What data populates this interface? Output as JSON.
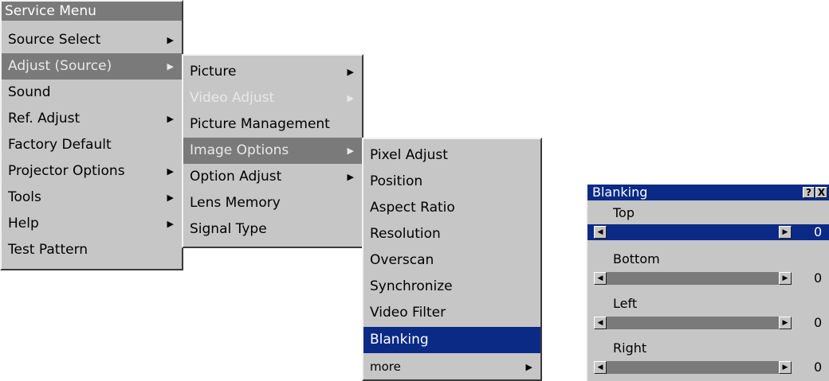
{
  "menu1": {
    "title": "Service Menu",
    "items": [
      {
        "label": "Source Select",
        "arrow": "▶"
      },
      {
        "label": "Adjust (Source)",
        "arrow": "▶"
      },
      {
        "label": "Sound",
        "arrow": ""
      },
      {
        "label": "Ref. Adjust",
        "arrow": "▶"
      },
      {
        "label": "Factory Default",
        "arrow": ""
      },
      {
        "label": "Projector Options",
        "arrow": "▶"
      },
      {
        "label": "Tools",
        "arrow": "▶"
      },
      {
        "label": "Help",
        "arrow": "▶"
      },
      {
        "label": "Test Pattern",
        "arrow": ""
      }
    ]
  },
  "menu2": {
    "items": [
      {
        "label": "Picture",
        "arrow": "▶"
      },
      {
        "label": "Video Adjust",
        "arrow": "▶"
      },
      {
        "label": "Picture Management",
        "arrow": ""
      },
      {
        "label": "Image Options",
        "arrow": "▶"
      },
      {
        "label": "Option Adjust",
        "arrow": "▶"
      },
      {
        "label": "Lens Memory",
        "arrow": ""
      },
      {
        "label": "Signal Type",
        "arrow": ""
      }
    ]
  },
  "menu3": {
    "items": [
      {
        "label": "Pixel Adjust",
        "arrow": ""
      },
      {
        "label": "Position",
        "arrow": ""
      },
      {
        "label": "Aspect Ratio",
        "arrow": ""
      },
      {
        "label": "Resolution",
        "arrow": ""
      },
      {
        "label": "Overscan",
        "arrow": ""
      },
      {
        "label": "Synchronize",
        "arrow": ""
      },
      {
        "label": "Video Filter",
        "arrow": ""
      },
      {
        "label": "Blanking",
        "arrow": ""
      },
      {
        "label": "more",
        "arrow": "▶"
      }
    ]
  },
  "dialog": {
    "title": "Blanking",
    "help_label": "?",
    "close_label": "X",
    "sliders": [
      {
        "label": "Top",
        "value": "0"
      },
      {
        "label": "Bottom",
        "value": "0"
      },
      {
        "label": "Left",
        "value": "0"
      },
      {
        "label": "Right",
        "value": "0"
      }
    ],
    "left_arrow": "◀",
    "right_arrow": "▶"
  },
  "colors": {
    "menu_bg": "#c6c6c6",
    "highlight_gray": "#7a7a7a",
    "selection_blue": "#0a2a86"
  }
}
